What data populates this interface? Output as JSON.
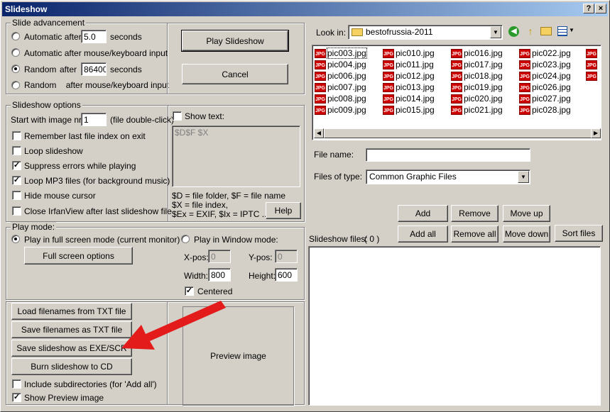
{
  "window": {
    "title": "Slideshow",
    "help_btn": "?",
    "close_btn": "×"
  },
  "advancement": {
    "title": "Slide advancement",
    "opt1_label": "Automatic after",
    "opt1_value": "5.0",
    "opt1_unit": "seconds",
    "opt2_label": "Automatic after mouse/keyboard input",
    "opt3_label": "Random",
    "opt3_after": "after",
    "opt3_value": "86400",
    "opt3_unit": "seconds",
    "opt4_label": "Random    after mouse/keyboard input"
  },
  "buttons": {
    "play": "Play Slideshow",
    "cancel": "Cancel"
  },
  "options": {
    "title": "Slideshow options",
    "start_label": "Start with image nr.:",
    "start_value": "1",
    "start_hint": "(file double-click)",
    "remember": "Remember last file index on exit",
    "loop": "Loop slideshow",
    "suppress": "Suppress errors while playing",
    "loopmp3": "Loop MP3 files (for background music)",
    "hidemouse": "Hide mouse cursor",
    "closeiv": "Close IrfanView after last slideshow file",
    "show_text": "Show text:",
    "text_value": "$D$F $X",
    "legend1": "$D = file folder, $F = file name",
    "legend2": "$X = file index,",
    "legend3": "$Ex = EXIF, $Ix = IPTC ...",
    "help": "Help"
  },
  "playmode": {
    "title": "Play mode:",
    "fullscreen": "Play in full screen mode (current monitor)",
    "fullscreen_opts": "Full screen options",
    "window": "Play in Window mode:",
    "xpos_label": "X-pos:",
    "xpos_value": "0",
    "ypos_label": "Y-pos:",
    "ypos_value": "0",
    "width_label": "Width:",
    "width_value": "800",
    "height_label": "Height:",
    "height_value": "600",
    "centered": "Centered"
  },
  "bottom": {
    "load_txt": "Load filenames from TXT file",
    "save_txt": "Save filenames as TXT file",
    "save_exe": "Save slideshow as  EXE/SCR",
    "burn_cd": "Burn slideshow to CD",
    "include_sub": "Include subdirectories (for 'Add all')",
    "show_preview": "Show Preview image",
    "preview_label": "Preview image"
  },
  "browser": {
    "lookin_label": "Look in:",
    "lookin_value": "bestofrussia-2011",
    "filename_label": "File name:",
    "filename_value": "",
    "filetype_label": "Files of type:",
    "filetype_value": "Common Graphic Files",
    "files_col1": [
      "pic003.jpg",
      "pic004.jpg",
      "pic006.jpg",
      "pic007.jpg",
      "pic008.jpg",
      "pic009.jpg"
    ],
    "files_col2": [
      "pic010.jpg",
      "pic011.jpg",
      "pic012.jpg",
      "pic013.jpg",
      "pic014.jpg",
      "pic015.jpg"
    ],
    "files_col3": [
      "pic016.jpg",
      "pic017.jpg",
      "pic018.jpg",
      "pic019.jpg",
      "pic020.jpg",
      "pic021.jpg"
    ],
    "files_col4": [
      "pic022.jpg",
      "pic023.jpg",
      "pic024.jpg",
      "pic026.jpg",
      "pic027.jpg",
      "pic028.jpg"
    ],
    "file_icon_text": "JPG"
  },
  "actions": {
    "add": "Add",
    "remove": "Remove",
    "moveup": "Move up",
    "addall": "Add all",
    "removeall": "Remove all",
    "movedown": "Move down",
    "sort": "Sort files",
    "slideshow_files_label": "Slideshow files:",
    "slideshow_count": "( 0 )"
  },
  "colors": {
    "accent_red": "#e31b1b",
    "title_blue": "#0a246a"
  }
}
